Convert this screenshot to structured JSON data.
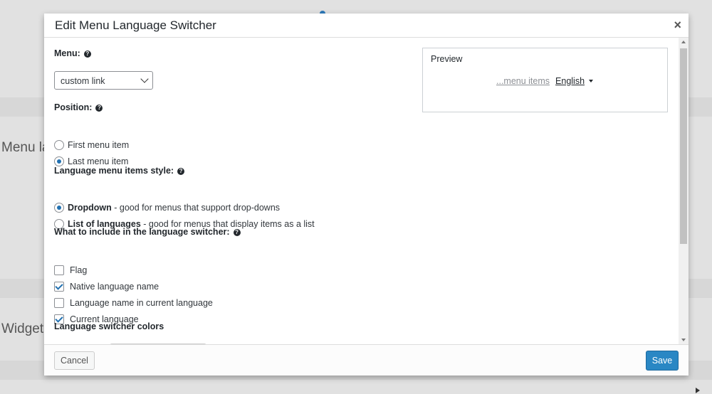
{
  "background": {
    "label_menu": "Menu la",
    "label_widget": "Widget"
  },
  "dialog": {
    "title": "Edit Menu Language Switcher",
    "close_glyph": "×",
    "help_glyph": "?"
  },
  "menu_field": {
    "label": "Menu:",
    "selected": "custom link"
  },
  "position_field": {
    "label": "Position:",
    "options": [
      {
        "label": "First menu item",
        "checked": false
      },
      {
        "label": "Last menu item",
        "checked": true
      }
    ]
  },
  "style_field": {
    "label": "Language menu items style:",
    "options": [
      {
        "label": "Dropdown",
        "description": " - good for menus that support drop-downs",
        "checked": true
      },
      {
        "label": "List of languages",
        "description": " - good for menus that display items as a list",
        "checked": false
      }
    ]
  },
  "include_field": {
    "label": "What to include in the language switcher:",
    "options": [
      {
        "label": "Flag",
        "checked": false
      },
      {
        "label": "Native language name",
        "checked": true
      },
      {
        "label": "Language name in current language",
        "checked": false
      },
      {
        "label": "Current language",
        "checked": true
      }
    ]
  },
  "colors_field": {
    "label": "Language switcher colors"
  },
  "preview": {
    "title": "Preview",
    "menu_items": "...menu items",
    "current_language": "English"
  },
  "footer": {
    "cancel_label": "Cancel",
    "save_label": "Save"
  },
  "colors": {
    "accent": "#2271b1",
    "save_button": "#2a87c4"
  }
}
